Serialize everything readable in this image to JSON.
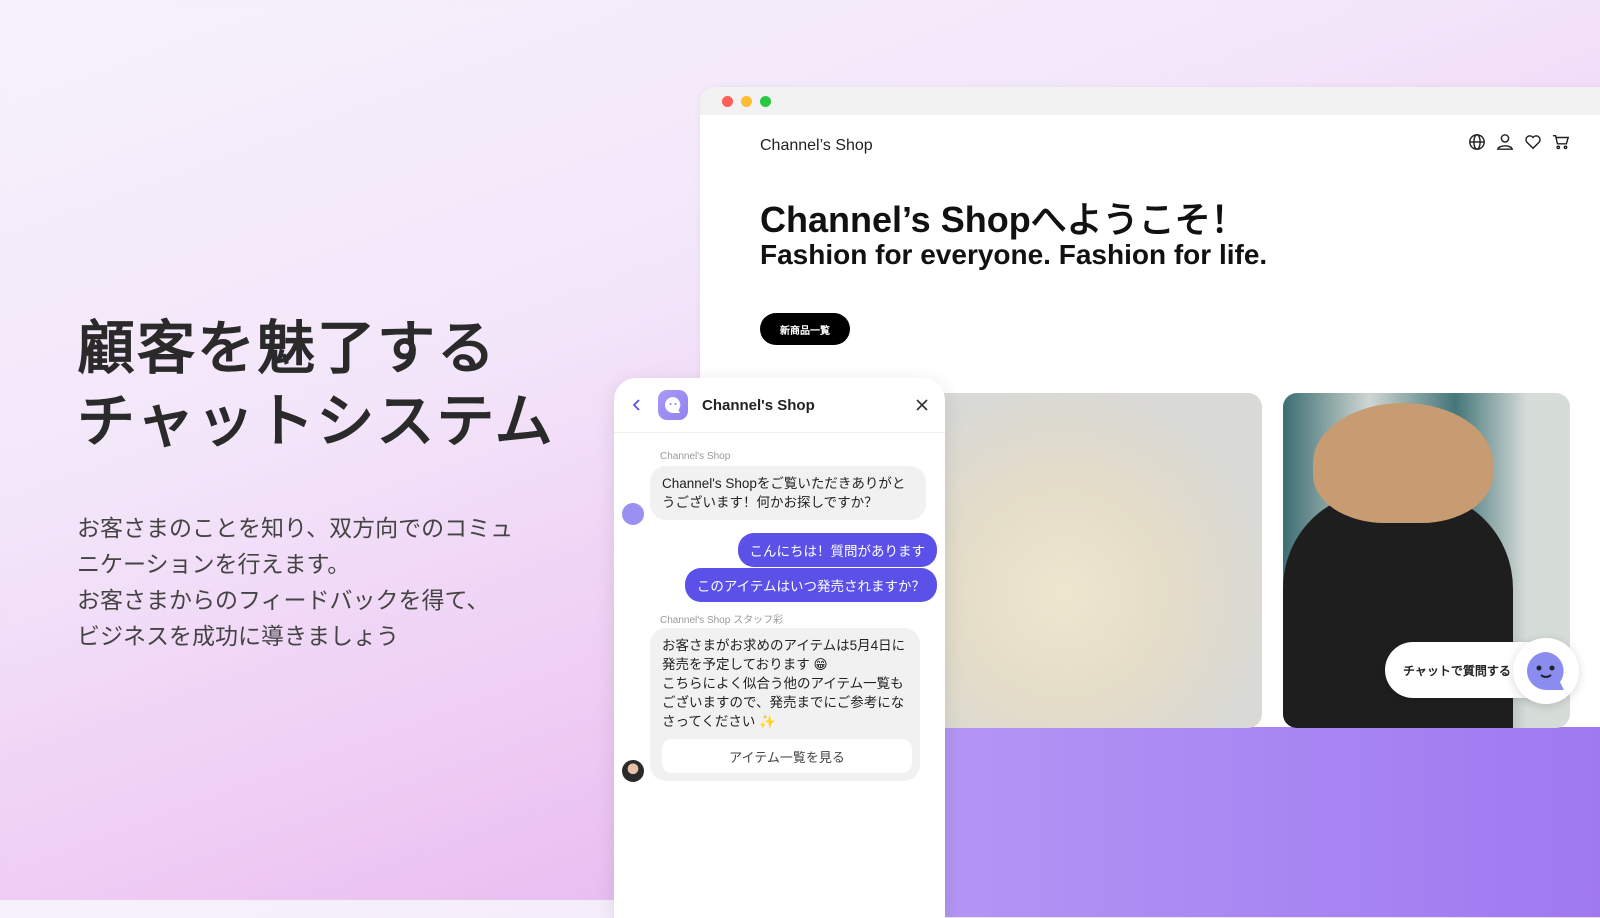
{
  "hero": {
    "line1": "顧客を魅了する",
    "line2": "チャットシステム",
    "desc": [
      "お客さまのことを知り、双方向でのコミュ",
      "ニケーションを行えます。",
      "お客さまからのフィードバックを得て、",
      "ビジネスを成功に導きましょう"
    ]
  },
  "browser": {
    "dots": [
      "#ff5f57",
      "#febc2e",
      "#28c840"
    ],
    "shop_name": "Channel’s Shop",
    "heading": "Channel’s Shopへようこそ！",
    "subheading": "Fashion for everyone. Fashion for life.",
    "cta": "新商品一覧",
    "icons": [
      "globe-icon",
      "user-icon",
      "heart-icon",
      "cart-icon"
    ],
    "chat_prompt": "チャットで質問する"
  },
  "chat": {
    "title": "Channel's Shop",
    "messages": [
      {
        "sender": "Channel's Shop",
        "text": "Channel's Shopをご覧いただきありがとうございます！何かお探しですか？"
      },
      {
        "me": "こんにちは！質問があります"
      },
      {
        "me": "このアイテムはいつ発売されますか？"
      },
      {
        "sender": "Channel's Shop スタッフ彩",
        "text": "お客さまがお求めのアイテムは5月4日に発売を予定しております 😁\nこちらによく似合う他のアイテム一覧もございますので、発売までにご参考になさってください ✨",
        "button": "アイテム一覧を見る"
      }
    ]
  },
  "colors": {
    "accent": "#5b50e8",
    "bottom": "#a483f2"
  }
}
